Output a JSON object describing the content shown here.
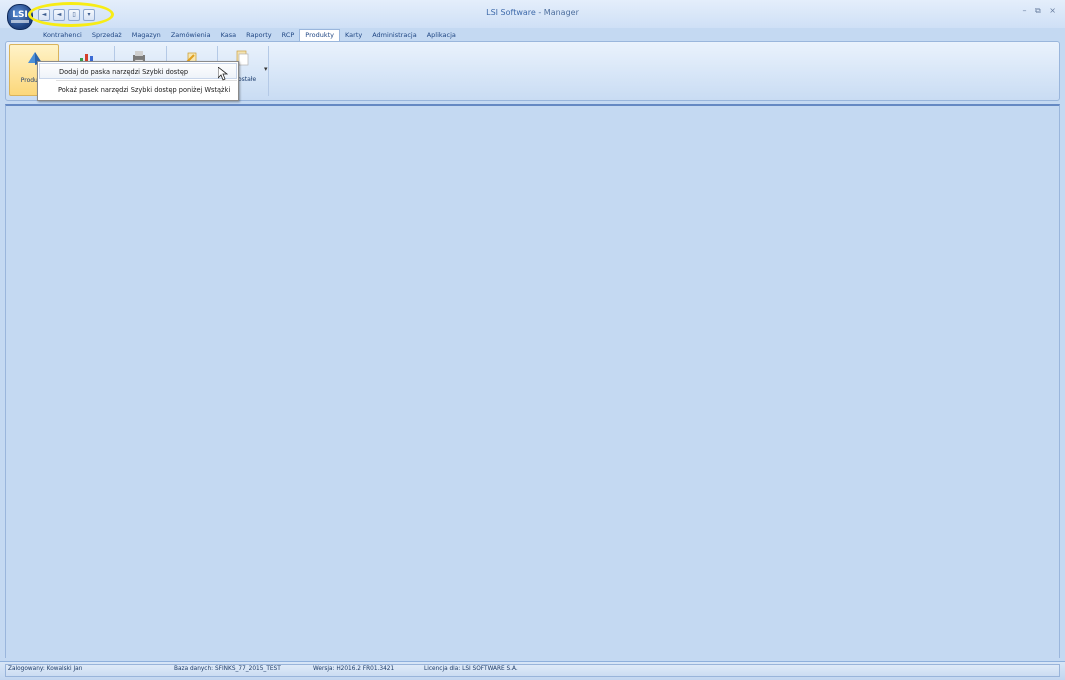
{
  "window": {
    "title_app": "LSI Software",
    "title_sep": " - ",
    "title_module": "Manager",
    "controls": "– ⧉ ×"
  },
  "logo": {
    "text": "LSI"
  },
  "quick_access": {
    "buttons": [
      {
        "icon": "back-arrow-icon",
        "glyph": "◄"
      },
      {
        "icon": "forward-arrow-icon",
        "glyph": "◄"
      },
      {
        "icon": "print-icon",
        "glyph": "▯"
      },
      {
        "icon": "dropdown-icon",
        "glyph": "▾"
      }
    ]
  },
  "menu": {
    "tabs": [
      {
        "label": "Kontrahenci",
        "active": false
      },
      {
        "label": "Sprzedaż",
        "active": false
      },
      {
        "label": "Magazyn",
        "active": false
      },
      {
        "label": "Zamówienia",
        "active": false
      },
      {
        "label": "Kasa",
        "active": false
      },
      {
        "label": "Raporty",
        "active": false
      },
      {
        "label": "RCP",
        "active": false
      },
      {
        "label": "Produkty",
        "active": true
      },
      {
        "label": "Karty",
        "active": false
      },
      {
        "label": "Administracja",
        "active": false
      },
      {
        "label": "Aplikacja",
        "active": false
      }
    ]
  },
  "ribbon": {
    "buttons": [
      {
        "label": "Produkty",
        "icon": "product-cube-icon",
        "color": "#4a8fd8"
      },
      {
        "label": "",
        "icon": "chart-icon",
        "color": "#d43e2a"
      },
      {
        "label": "",
        "icon": "printer-icon",
        "color": "#6a6a6a"
      },
      {
        "label": "",
        "icon": "edit-icon",
        "color": "#e0a020"
      },
      {
        "label": "Pozostałe",
        "icon": "document-icon",
        "color": "#d8a83a"
      }
    ]
  },
  "context_menu": {
    "items": [
      {
        "label": "Dodaj do paska narzędzi Szybki dostęp"
      },
      {
        "label": "Pokaż pasek narzędzi Szybki dostęp poniżej Wstążki"
      }
    ]
  },
  "status": {
    "user": "Zalogowany: Kowalski Jan",
    "database": "Baza danych: SFINKS_77_2015_TEST",
    "version": "Wersja: H2016.2 FR01.3421",
    "license": "Licencja dla: LSI SOFTWARE S.A."
  }
}
